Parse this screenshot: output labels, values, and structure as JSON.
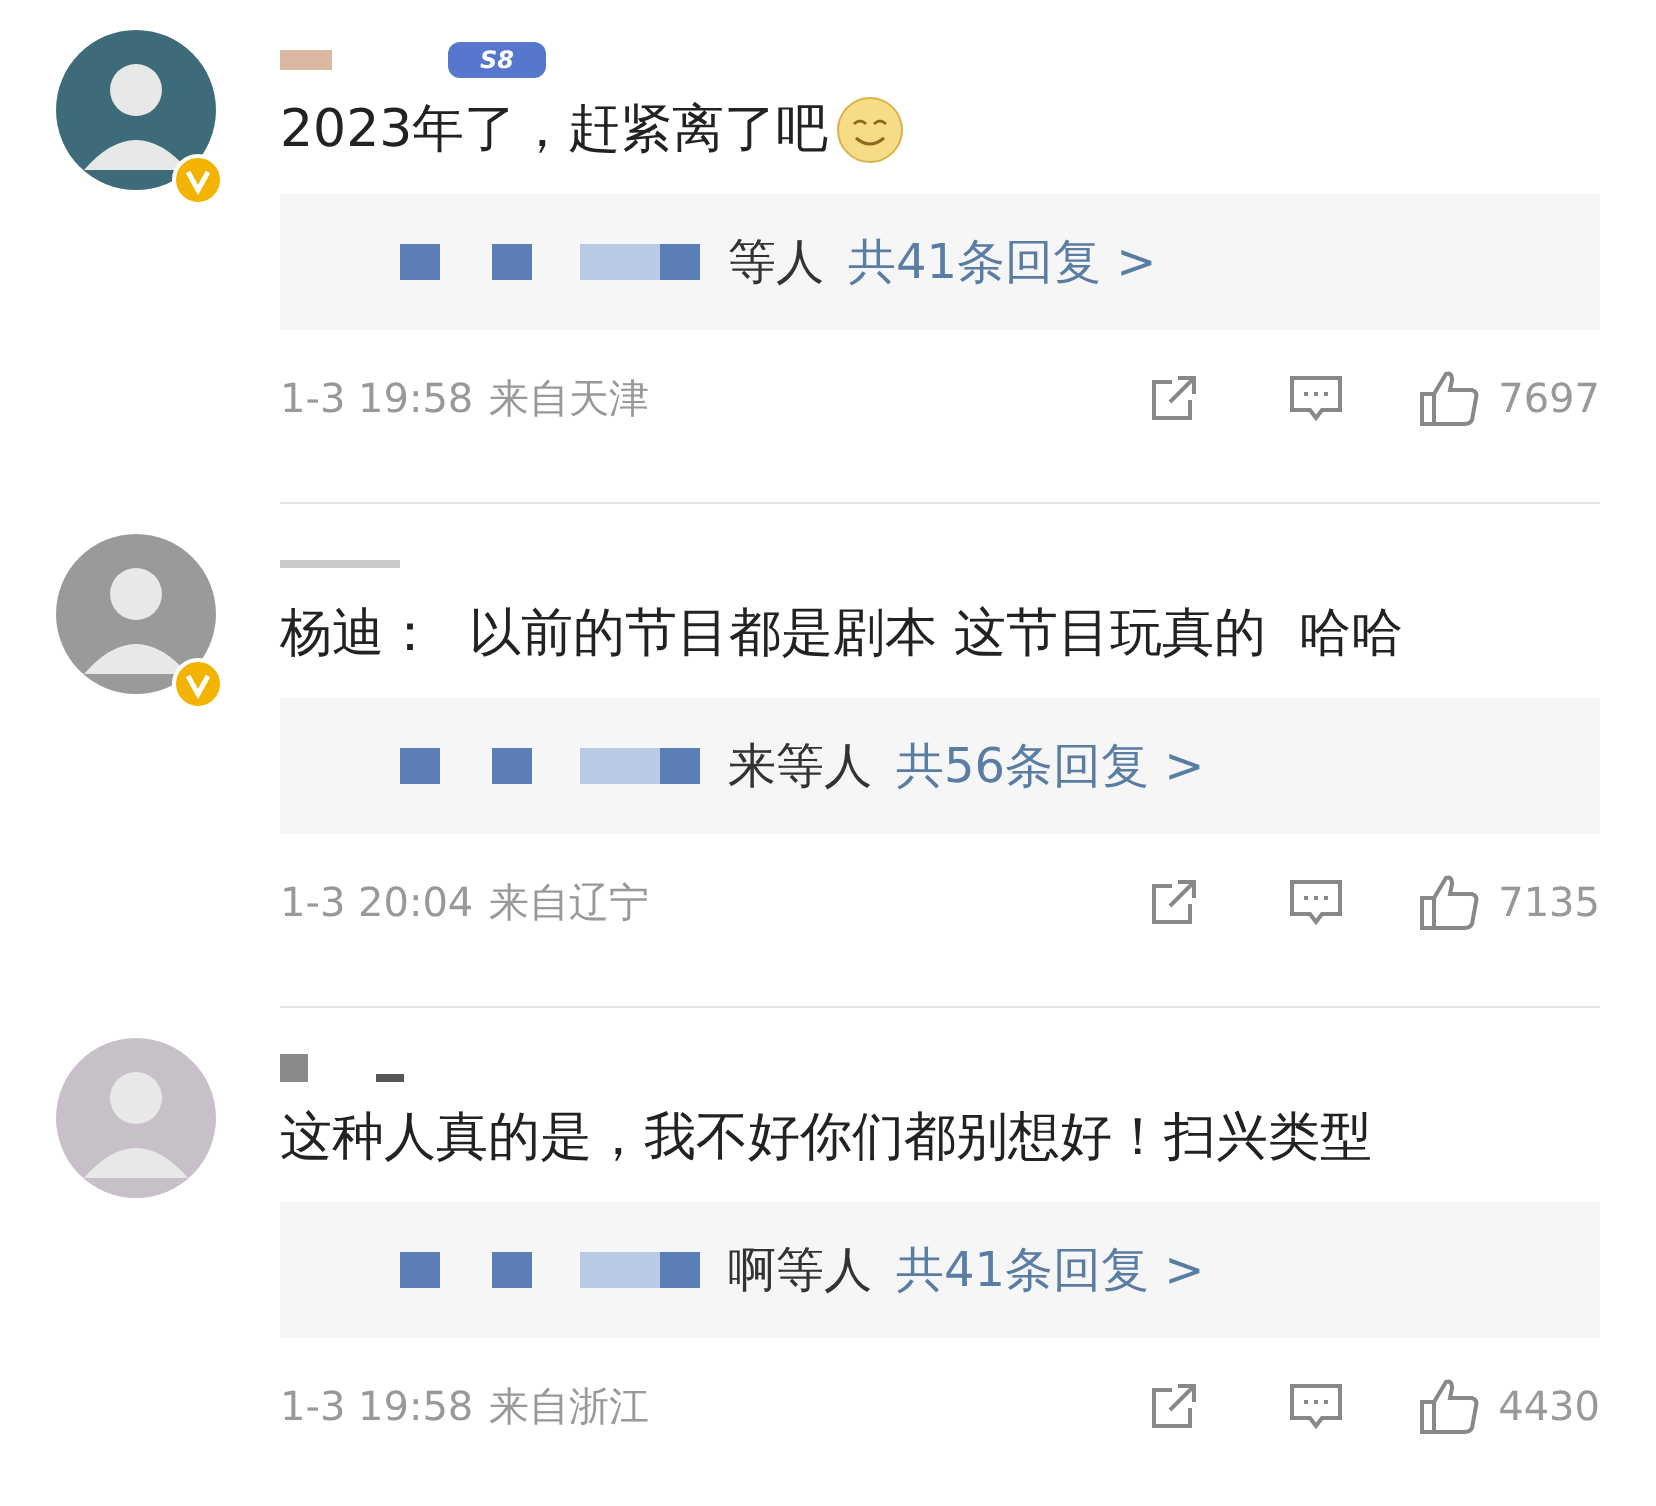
{
  "comments": [
    {
      "verified": true,
      "level_badge": "S8",
      "text": "2023年了，赶紧离了吧",
      "trailing_emoji": true,
      "replies_from": "等人",
      "replies_count": "共41条回复 >",
      "time": "1-3 19:58",
      "location": "来自天津",
      "likes": "7697"
    },
    {
      "verified": true,
      "text": "杨迪：  以前的节目都是剧本 这节目玩真的  哈哈",
      "trailing_emoji": false,
      "replies_from": "来等人",
      "replies_count": "共56条回复 >",
      "time": "1-3 20:04",
      "location": "来自辽宁",
      "likes": "7135"
    },
    {
      "verified": false,
      "text": "这种人真的是，我不好你们都别想好！扫兴类型",
      "trailing_emoji": false,
      "replies_from": "啊等人",
      "replies_count": "共41条回复 >",
      "time": "1-3 19:58",
      "location": "来自浙江",
      "likes": "4430"
    }
  ]
}
